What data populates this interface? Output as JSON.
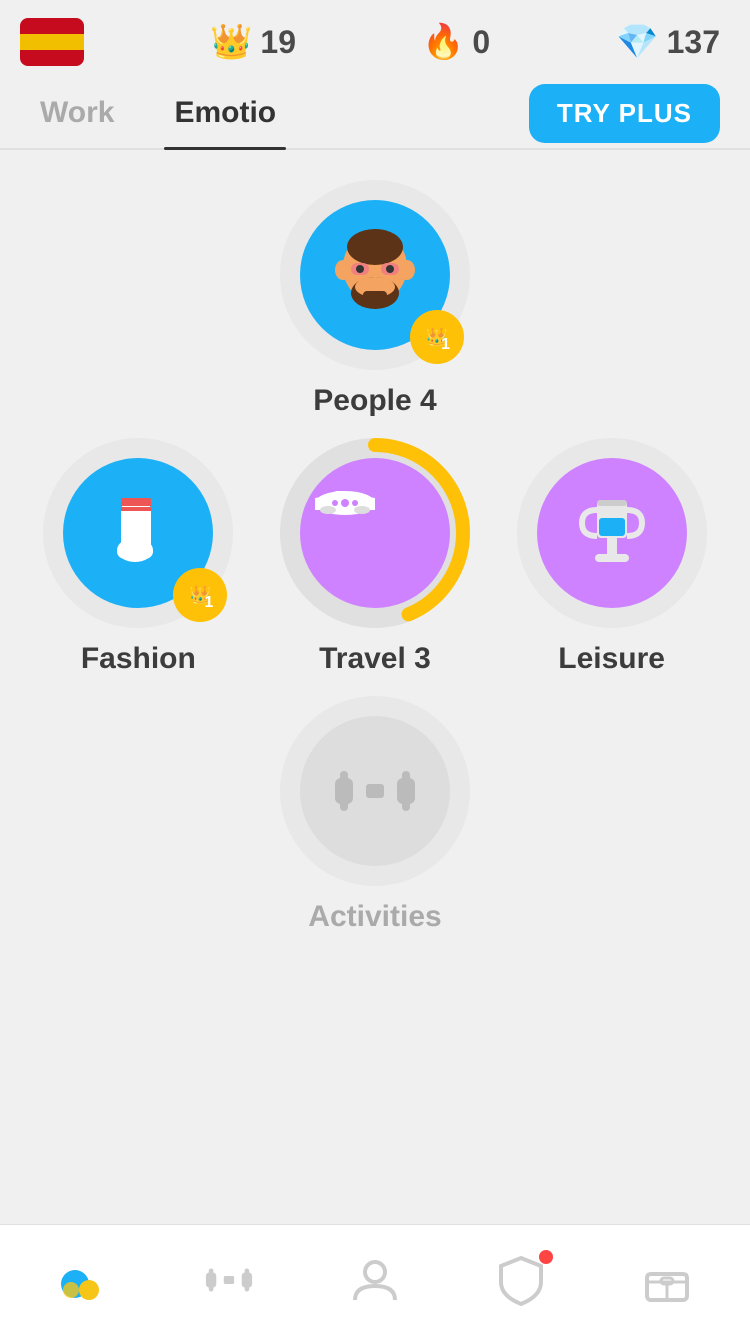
{
  "topBar": {
    "streakCount": "19",
    "flameCount": "0",
    "gemCount": "137"
  },
  "navTabs": {
    "tab1": "Work",
    "tab2": "Emotio",
    "tryPlusLabel": "TRY PLUS"
  },
  "lessons": {
    "row1": {
      "name": "People 4",
      "badgeNumber": "1",
      "circleColor": "blue"
    },
    "row2": [
      {
        "name": "Fashion",
        "badgeNumber": "1",
        "circleColor": "blue",
        "icon": "🧦"
      },
      {
        "name": "Travel 3",
        "hasProgress": true,
        "circleColor": "purple",
        "icon": "✈️"
      },
      {
        "name": "Leisure",
        "circleColor": "light-purple",
        "icon": "🏆"
      }
    ],
    "row3": {
      "name": "Activities",
      "circleColor": "gray",
      "icon": "🏋️",
      "locked": true
    }
  },
  "bottomNav": {
    "items": [
      {
        "name": "home",
        "label": "",
        "active": true
      },
      {
        "name": "activities",
        "label": "",
        "active": false
      },
      {
        "name": "profile",
        "label": "",
        "active": false
      },
      {
        "name": "shield",
        "label": "",
        "active": false,
        "hasNotification": true
      },
      {
        "name": "shop",
        "label": "",
        "active": false
      }
    ]
  }
}
